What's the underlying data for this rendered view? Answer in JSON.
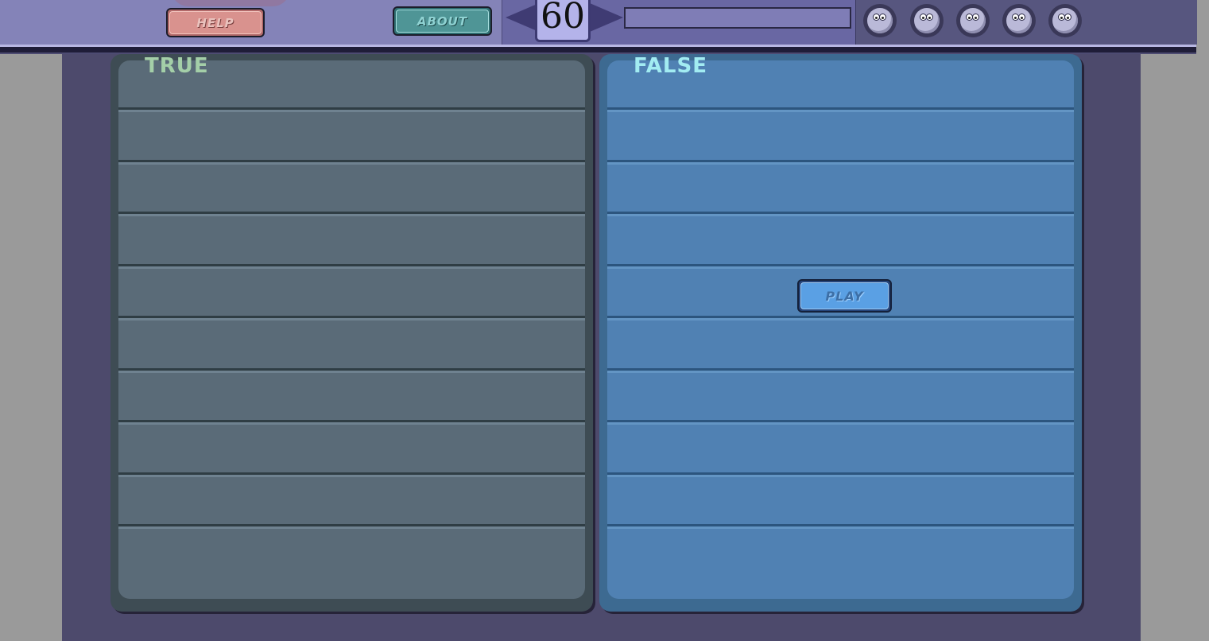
{
  "header": {
    "help_label": "HELP",
    "about_label": "ABOUT",
    "timer_value": "60",
    "time_progress": 0,
    "lives": [
      {
        "icon": "life-face-icon"
      },
      {
        "icon": "life-face-icon"
      },
      {
        "icon": "life-face-icon"
      },
      {
        "icon": "life-face-icon"
      },
      {
        "icon": "life-face-icon"
      }
    ]
  },
  "panels": {
    "true": {
      "title": "TRUE",
      "row_count": 10,
      "color": "#5a6b78"
    },
    "false": {
      "title": "FALSE",
      "row_count": 10,
      "color": "#5081b3"
    }
  },
  "play_label": "PLAY"
}
